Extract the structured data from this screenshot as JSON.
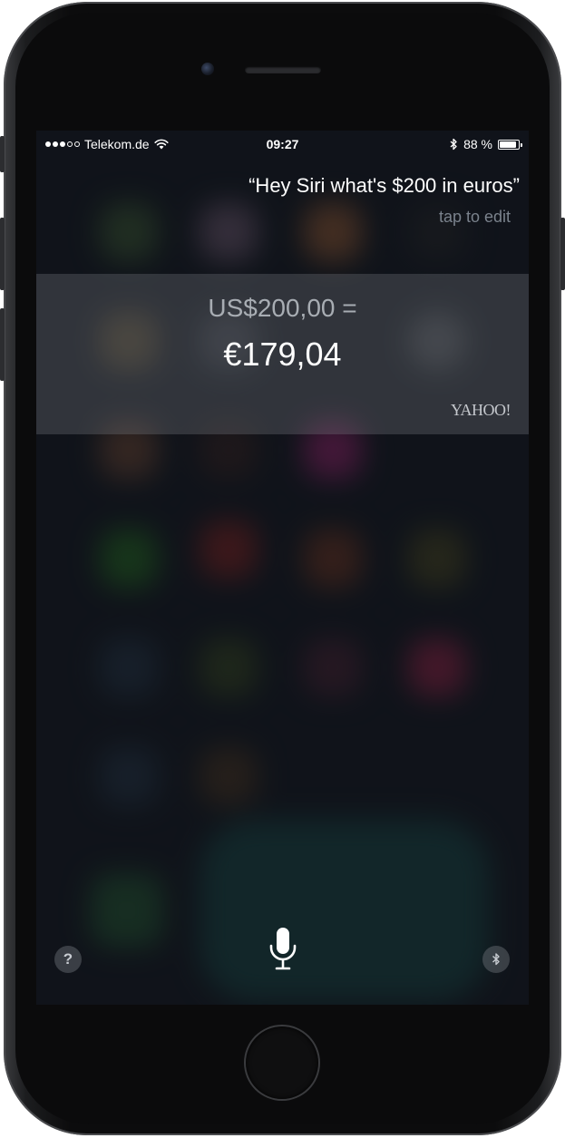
{
  "status_bar": {
    "signal_filled": 3,
    "signal_empty": 2,
    "carrier": "Telekom.de",
    "time": "09:27",
    "battery_percent": "88 %",
    "battery_level": 0.88
  },
  "siri": {
    "query": "“Hey Siri what's $200 in euros”",
    "tap_to_edit": "tap to edit"
  },
  "conversion_card": {
    "from_amount": "US$200,00 =",
    "to_amount": "€179,04",
    "source": "YAHOO!"
  },
  "bottom_bar": {
    "help_label": "?",
    "mic_icon": "microphone-icon",
    "bluetooth_icon": "bluetooth-icon"
  },
  "colors": {
    "text_primary": "#ffffff",
    "text_secondary": "#a8adb3",
    "text_hint": "#7a828c",
    "card_background": "rgba(120,124,130,0.32)"
  }
}
